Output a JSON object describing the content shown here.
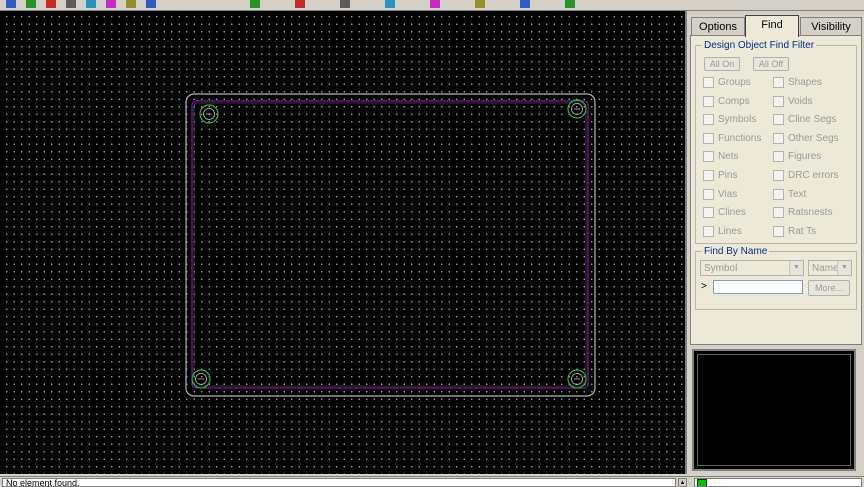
{
  "toolbar": {
    "icons": [
      "open-icon",
      "save-icon",
      "undo-icon",
      "redo-icon",
      "zoom-in-icon",
      "zoom-out-icon",
      "zoom-fit-icon",
      "layer-icon",
      "grid-icon",
      "route-icon",
      "via-icon",
      "drc-icon",
      "shape-icon",
      "text-icon",
      "measure-icon",
      "highlight-icon"
    ]
  },
  "panel": {
    "tabs": [
      {
        "label": "Options"
      },
      {
        "label": "Find"
      },
      {
        "label": "Visibility"
      }
    ],
    "active_tab": "Find",
    "find_filter": {
      "legend": "Design Object Find Filter",
      "all_on": "All On",
      "all_off": "All Off",
      "items_left": [
        "Groups",
        "Comps",
        "Symbols",
        "Functions",
        "Nets",
        "Pins",
        "Vias",
        "Clines",
        "Lines"
      ],
      "items_right": [
        "Shapes",
        "Voids",
        "Cline Segs",
        "Other Segs",
        "Figures",
        "DRC errors",
        "Text",
        "Ratsnests",
        "Rat Ts"
      ]
    },
    "find_by_name": {
      "legend": "Find By Name",
      "type_value": "Symbol",
      "mode_value": "Name",
      "prompt": ">",
      "input_value": "",
      "more_button": "More..."
    }
  },
  "status": {
    "message": "No element found.",
    "right_text": "",
    "indicator_color": "#00c000"
  },
  "colors": {
    "canvas_bg": "#000000",
    "board_outline": "#b0b0b0",
    "route_keepin": "#a020c0",
    "mounting_hole": "#20c040"
  }
}
